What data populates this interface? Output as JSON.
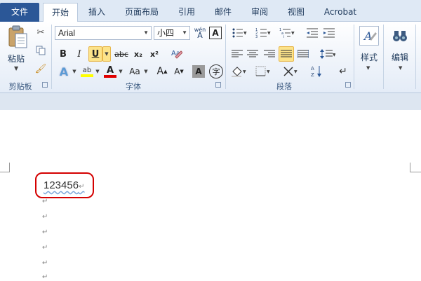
{
  "tabs": [
    "文件",
    "开始",
    "插入",
    "页面布局",
    "引用",
    "邮件",
    "审阅",
    "视图",
    "Acrobat"
  ],
  "clipboard": {
    "paste": "粘贴",
    "label": "剪贴板"
  },
  "font": {
    "name": "Arial",
    "size": "小四",
    "label": "字体",
    "bold": "B",
    "italic": "I",
    "underline": "U",
    "strike": "abc",
    "sub": "x₂",
    "sup": "x²",
    "wen": "wén",
    "boxA": "A",
    "case": "Aa",
    "grow": "A",
    "shrink": "A",
    "circ": "字",
    "shadeA": "A"
  },
  "paragraph": {
    "label": "段落"
  },
  "styles": {
    "label": "样式"
  },
  "editing": {
    "label": "编辑"
  },
  "document": {
    "text": "123456",
    "para_mark": "↵"
  }
}
